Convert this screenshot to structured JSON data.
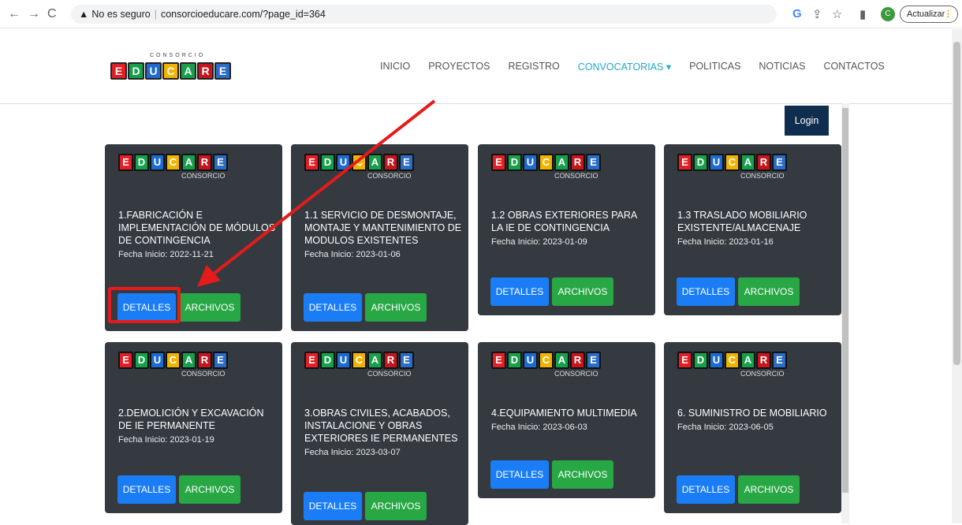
{
  "browser": {
    "warning": "No es seguro",
    "url": "consorcioeducare.com/?page_id=364",
    "avatar_letter": "C",
    "update_label": "Actualizar"
  },
  "logo": {
    "small_text": "CONSORCIO",
    "letters": [
      "E",
      "D",
      "U",
      "C",
      "A",
      "R",
      "E"
    ],
    "colors": [
      "#e31e24",
      "#17a04b",
      "#1e6bd0",
      "#f0b400",
      "#17a04b",
      "#c4161c",
      "#2b6cc4"
    ]
  },
  "menu": [
    "INICIO",
    "PROYECTOS",
    "REGISTRO",
    "CONVOCATORIAS ▾",
    "POLITICAS",
    "NOTICIAS",
    "CONTACTOS"
  ],
  "login": "Login",
  "card_logo_caption": "CONSORCIO",
  "buttons": {
    "detalles": "DETALLES",
    "archivos": "ARCHIVOS"
  },
  "cards": [
    {
      "title": "1.FABRICACIÓN E IMPLEMENTACIÓN DE MÓDULOS DE CONTINGENCIA",
      "date": "Fecha Inicio: 2022-11-21"
    },
    {
      "title": "1.1 SERVICIO DE DESMONTAJE, MONTAJE Y MANTENIMIENTO DE MODULOS EXISTENTES",
      "date": "Fecha Inicio: 2023-01-06"
    },
    {
      "title": "1.2 OBRAS EXTERIORES PARA LA IE DE CONTINGENCIA",
      "date": "Fecha Inicio: 2023-01-09"
    },
    {
      "title": "1.3 TRASLADO MOBILIARIO EXISTENTE/ALMACENAJE",
      "date": "Fecha Inicio: 2023-01-16"
    },
    {
      "title": "2.DEMOLICIÓN Y EXCAVACIÓN DE IE PERMANENTE",
      "date": "Fecha Inicio: 2023-01-19"
    },
    {
      "title": "3.OBRAS CIVILES, ACABADOS, INSTALACIONE Y OBRAS EXTERIORES IE PERMANENTES",
      "date": "Fecha Inicio: 2023-03-07"
    },
    {
      "title": "4.EQUIPAMIENTO MULTIMEDIA",
      "date": "Fecha Inicio: 2023-06-03"
    },
    {
      "title": "6. SUMINISTRO DE MOBILIARIO",
      "date": "Fecha Inicio: 2023-06-05"
    }
  ]
}
